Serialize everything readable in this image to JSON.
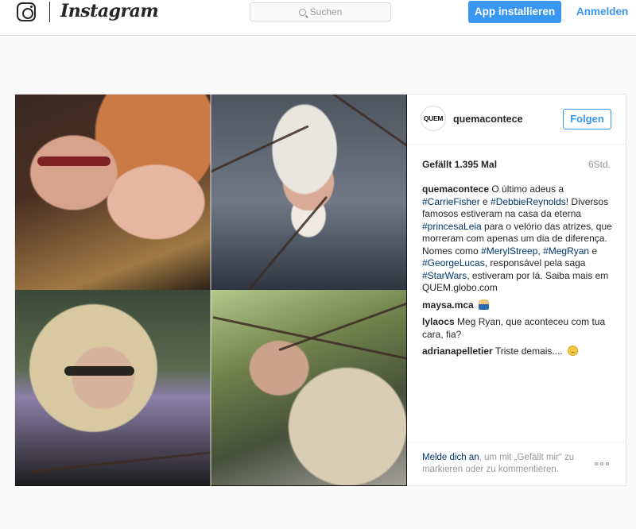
{
  "app": {
    "brand": "Instagram",
    "icons": {
      "logo": "instagram-camera-icon",
      "search": "search-icon",
      "more": "more-options-icon"
    }
  },
  "topbar": {
    "search_placeholder": "Suchen",
    "install_label": "App installieren",
    "login_label": "Anmelden"
  },
  "post": {
    "avatar_text": "QUEM",
    "username": "quemacontece",
    "follow_label": "Folgen",
    "likes": "Gefällt 1.395 Mal",
    "time": "6Std.",
    "caption": {
      "username": "quemacontece",
      "parts": [
        "O último adeus a ",
        "#CarrieFisher",
        " e ",
        "#DebbieReynolds",
        "! Diversos famosos estiveram na casa da eterna ",
        "#princesaLeia",
        " para o velório das atrizes, que morreram com apenas um dia de diferença. Nomes como ",
        "#MerylStreep",
        ", ",
        "#MegRyan",
        " e ",
        "#GeorgeLucas",
        ", responsável pela saga ",
        "#StarWars",
        ", estiveram por lá. Saiba mais em QUEM.globo.com"
      ]
    },
    "comments": [
      {
        "username": "maysa.mca",
        "text": "",
        "emoji": "person-emoji-icon"
      },
      {
        "username": "lylaocs",
        "text": "Meg Ryan, que aconteceu com tua cara, fia?",
        "emoji": ""
      },
      {
        "username": "adrianapelletier",
        "text": "Triste demais....",
        "emoji": "sad-face-emoji-icon"
      }
    ],
    "footer": {
      "login_link": "Melde dich an",
      "rest": ", um mit „Gefällt mir“ zu markieren oder zu kommentieren."
    }
  },
  "colors": {
    "accent": "#3897f0",
    "hashtag": "#003569",
    "muted": "#999999",
    "text": "#262626",
    "background": "#fafafa"
  }
}
